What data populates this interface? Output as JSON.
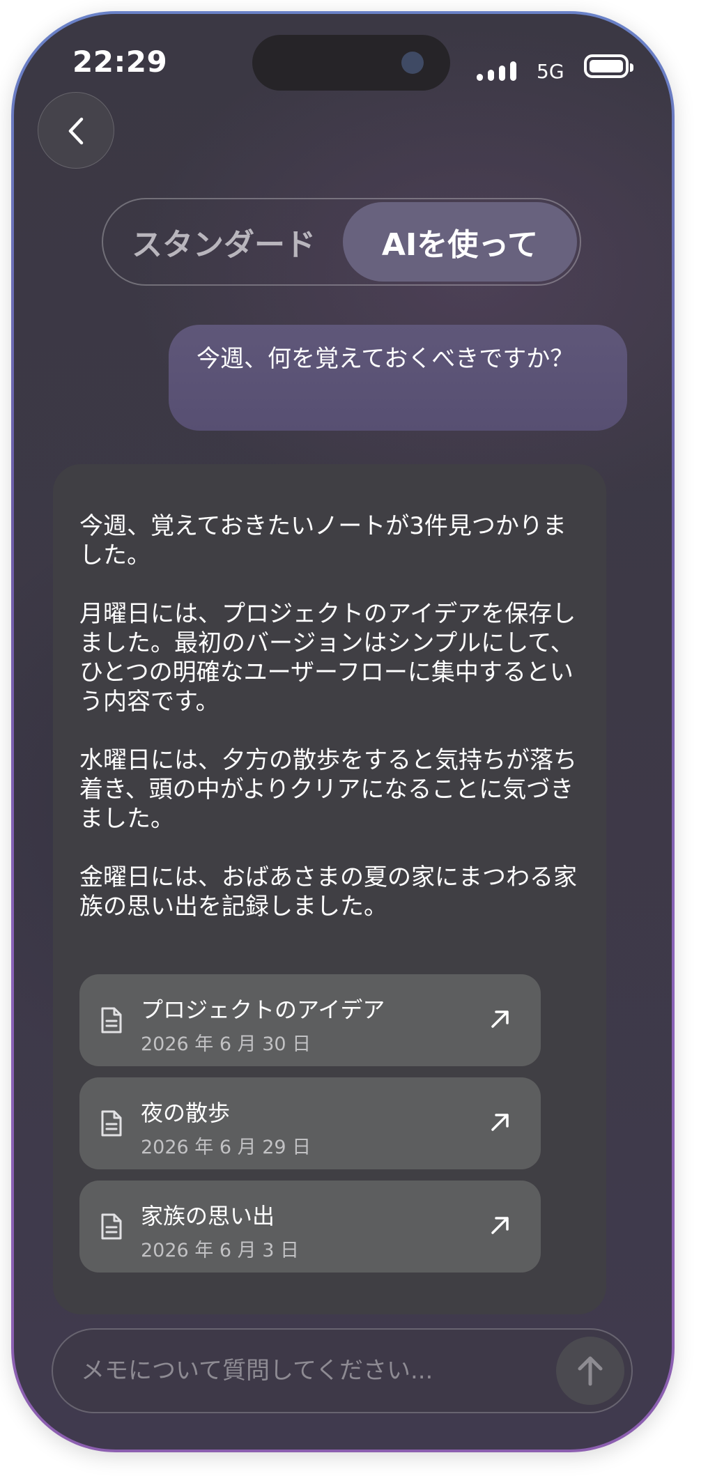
{
  "status_bar": {
    "time": "22:29",
    "network": "5G"
  },
  "mode_toggle": {
    "standard_label": "スタンダード",
    "ai_label": "AIを使って",
    "selected": "AIを使って"
  },
  "chat": {
    "user_message": "今週、何を覚えておくべきですか？",
    "response": {
      "paragraphs": [
        "今週、覚えておきたいノートが3件見つかりました。",
        "月曜日には、プロジェクトのアイデアを保存しました。最初のバージョンはシンプルにして、ひとつの明確なユーザーフローに集中するという内容です。",
        "水曜日には、夕方の散歩をすると気持ちが落ち着き、頭の中がよりクリアになることに気づきました。",
        "金曜日には、おばあさまの夏の家にまつわる家族の思い出を記録しました。"
      ],
      "notes": [
        {
          "title": "プロジェクトのアイデア",
          "date": "2026 年 6 月 30 日"
        },
        {
          "title": "夜の散歩",
          "date": "2026 年 6 月 29 日"
        },
        {
          "title": "家族の思い出",
          "date": "2026 年 6 月 3 日"
        }
      ]
    }
  },
  "composer": {
    "placeholder": "メモについて質問してください..."
  },
  "icons": {
    "back": "chevron-left-icon",
    "note": "document-icon",
    "open": "arrow-up-right-icon",
    "send": "arrow-up-icon"
  },
  "colors": {
    "active_segment": "#68627e",
    "user_bubble": "#5a5275",
    "response_card": "#403f44",
    "note_card": "#5d5e5f"
  }
}
